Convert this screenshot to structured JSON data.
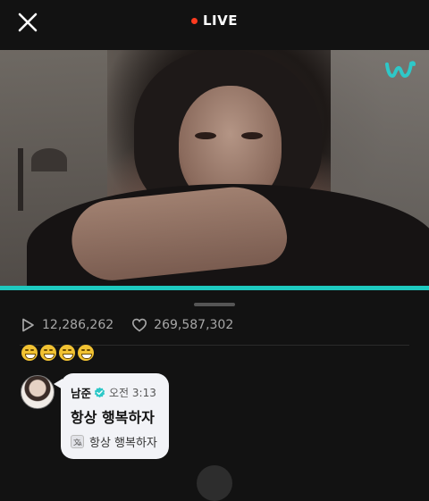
{
  "header": {
    "close_icon": "close-icon",
    "live_label": "LIVE",
    "live_dot_color": "#ff3b1f"
  },
  "video": {
    "logo_icon": "weverse-logo",
    "logo_color": "#2ec8c8",
    "progress_fraction": 1.0,
    "progress_color": "#1ec9bf"
  },
  "stats": {
    "plays_icon": "play-icon",
    "plays": "12,286,262",
    "likes_icon": "heart-icon",
    "likes": "269,587,302"
  },
  "emoji_row": [
    "grinning-emoji",
    "grinning-emoji",
    "grinning-emoji",
    "grinning-emoji"
  ],
  "comment": {
    "author": "남준",
    "verified_icon": "verified-badge-icon",
    "verified_color": "#2ec8c8",
    "time": "오전 3:13",
    "message": "항상 행복하자",
    "translate_icon": "translate-icon",
    "translation": "항상 행복하자"
  }
}
